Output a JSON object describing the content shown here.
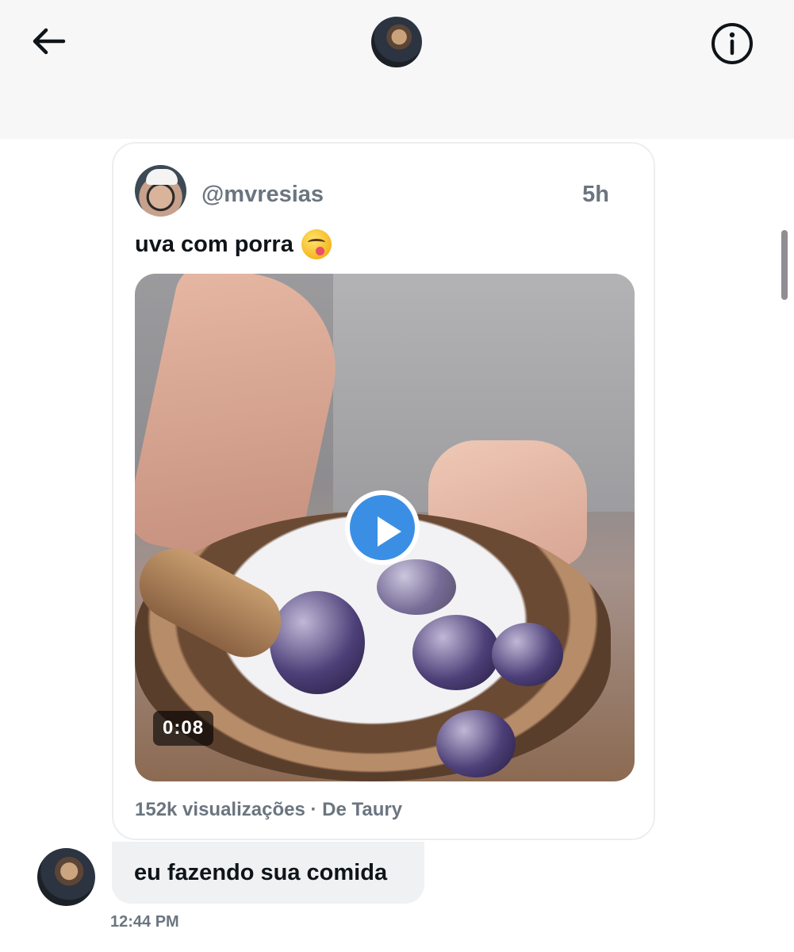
{
  "header": {
    "back_icon": "arrow-left-icon",
    "info_icon": "info-circle-icon"
  },
  "shared_post": {
    "handle": "@mvresias",
    "time": "5h",
    "text": "uva com porra",
    "emoji": "😋",
    "video": {
      "duration": "0:08"
    },
    "footer": "152k visualizações · De Taury"
  },
  "message": {
    "text": "eu fazendo sua comida",
    "timestamp": "12:44 PM"
  },
  "colors": {
    "accent": "#3a8fe5",
    "muted_text": "#6b7580",
    "bubble_bg": "#eff1f3",
    "header_bg": "#f7f7f8"
  }
}
